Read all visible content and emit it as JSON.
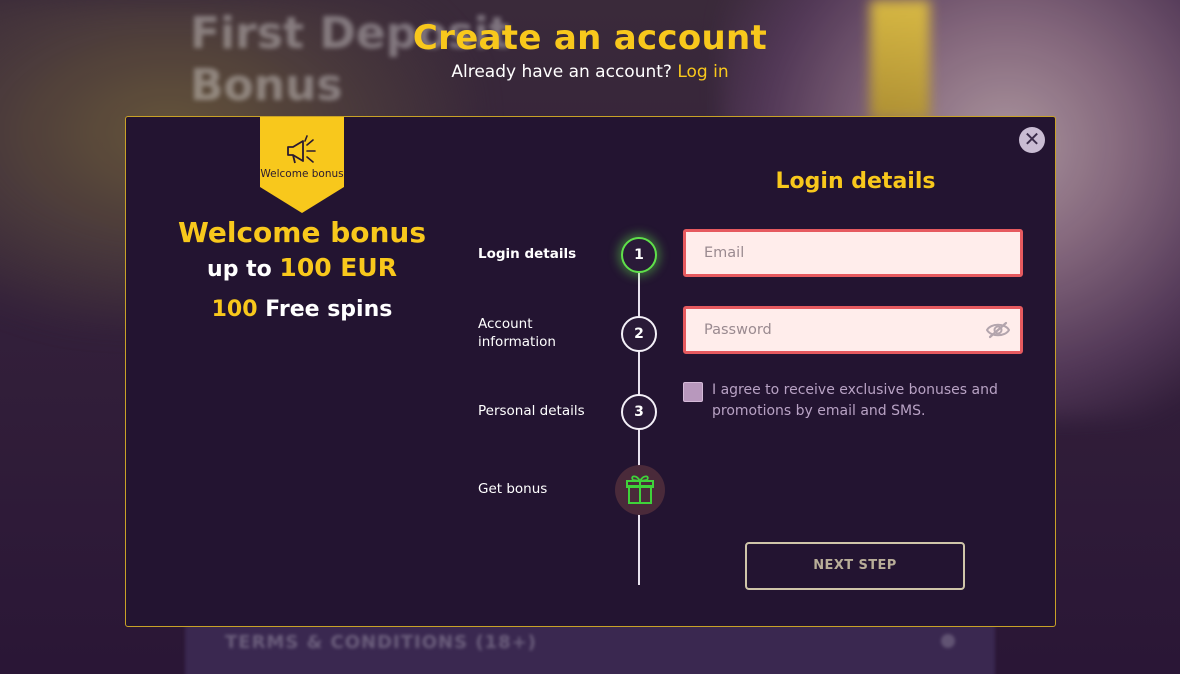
{
  "background": {
    "blurred_title": "First Deposit Bonus",
    "blurred_footer": "TERMS & CONDITIONS (18+)"
  },
  "header": {
    "title": "Create an account",
    "subtitle": "Already have an account?",
    "login_link": "Log in"
  },
  "modal": {
    "close_icon": "close-icon",
    "ribbon": {
      "icon": "megaphone-icon",
      "text": "Welcome bonus"
    },
    "bonus": {
      "title": "Welcome bonus",
      "prefix": "up to",
      "amount": "100 EUR",
      "spins_count": "100",
      "spins_label": "Free spins"
    },
    "steps": [
      {
        "label": "Login details",
        "number": "1",
        "active": true
      },
      {
        "label": "Account information",
        "number": "2",
        "active": false
      },
      {
        "label": "Personal details",
        "number": "3",
        "active": false
      },
      {
        "label": "Get bonus",
        "icon": "gift-icon",
        "active": false
      }
    ],
    "form": {
      "title": "Login details",
      "email_placeholder": "Email",
      "password_placeholder": "Password",
      "consent": "I agree to receive exclusive bonuses and promotions by email and SMS.",
      "next_button": "NEXT STEP"
    }
  },
  "colors": {
    "accent": "#f8c81c",
    "modal_bg": "#231431",
    "error_border": "#e65a5f",
    "active_step": "#5fe04a"
  }
}
